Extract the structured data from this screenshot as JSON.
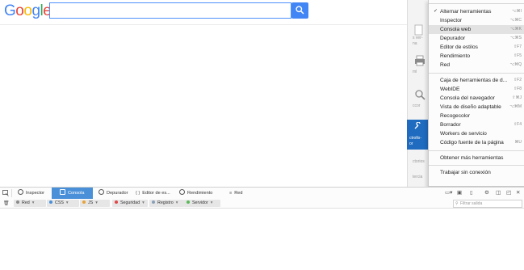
{
  "google": {
    "logo_letters": [
      {
        "ch": "G",
        "color": "#4285F4"
      },
      {
        "ch": "o",
        "color": "#EA4335"
      },
      {
        "ch": "o",
        "color": "#FBBC05"
      },
      {
        "ch": "g",
        "color": "#4285F4"
      },
      {
        "ch": "l",
        "color": "#34A853"
      },
      {
        "ch": "e",
        "color": "#EA4335"
      }
    ],
    "search_value": "",
    "search_icon": "search-icon"
  },
  "side_panel": {
    "texts": [
      "s ver-",
      "na",
      "ml",
      "ccor",
      "ctrollo-",
      "or",
      "ctorios",
      "tercia"
    ]
  },
  "menu": {
    "items": [
      {
        "label": "Alternar herramientas",
        "shortcut": "⌥⌘I",
        "checked": true,
        "highlighted": false
      },
      {
        "label": "Inspector",
        "shortcut": "⌥⌘C",
        "checked": false,
        "highlighted": false
      },
      {
        "label": "Consola web",
        "shortcut": "⌥⌘K",
        "checked": false,
        "highlighted": true
      },
      {
        "label": "Depurador",
        "shortcut": "⌥⌘S",
        "checked": false,
        "highlighted": false
      },
      {
        "label": "Editor de estilos",
        "shortcut": "⇧F7",
        "checked": false,
        "highlighted": false
      },
      {
        "label": "Rendimiento",
        "shortcut": "⇧F5",
        "checked": false,
        "highlighted": false
      },
      {
        "label": "Red",
        "shortcut": "⌥⌘Q",
        "checked": false,
        "highlighted": false
      },
      {
        "label": "Caja de herramientas de d...",
        "shortcut": "⇧F2",
        "checked": false,
        "highlighted": false
      },
      {
        "label": "WebIDE",
        "shortcut": "⇧F8",
        "checked": false,
        "highlighted": false
      },
      {
        "label": "Consola del navegador",
        "shortcut": "⇧⌘J",
        "checked": false,
        "highlighted": false
      },
      {
        "label": "Vista de diseño adaptable",
        "shortcut": "⌥⌘M",
        "checked": false,
        "highlighted": false
      },
      {
        "label": "Recogecolor",
        "shortcut": "",
        "checked": false,
        "highlighted": false
      },
      {
        "label": "Borrador",
        "shortcut": "⇧F4",
        "checked": false,
        "highlighted": false
      },
      {
        "label": "Workers de servicio",
        "shortcut": "",
        "checked": false,
        "highlighted": false
      },
      {
        "label": "Código fuente de la página",
        "shortcut": "⌘U",
        "checked": false,
        "highlighted": false
      },
      {
        "label": "Obtener más herramientas",
        "shortcut": "",
        "checked": false,
        "highlighted": false
      },
      {
        "label": "Trabajar sin conexión",
        "shortcut": "",
        "checked": false,
        "highlighted": false
      }
    ]
  },
  "devtools": {
    "tabs": [
      {
        "label": "Inspector",
        "active": false
      },
      {
        "label": "Consola",
        "active": true
      },
      {
        "label": "Depurador",
        "active": false
      },
      {
        "label": "Editor de es...",
        "active": false
      },
      {
        "label": "Rendimiento",
        "active": false
      },
      {
        "label": "Red",
        "active": false
      }
    ],
    "filters": [
      {
        "label": "Red",
        "color": "#8a8a8a"
      },
      {
        "label": "CSS",
        "color": "#4a90d9"
      },
      {
        "label": "JS",
        "color": "#e8a33a"
      },
      {
        "label": "Seguridad",
        "color": "#e04848"
      },
      {
        "label": "Registro",
        "color": "#8aa0b8"
      },
      {
        "label": "Servidor",
        "color": "#5cb85c"
      }
    ],
    "filter_placeholder": "Filtrar salida"
  }
}
